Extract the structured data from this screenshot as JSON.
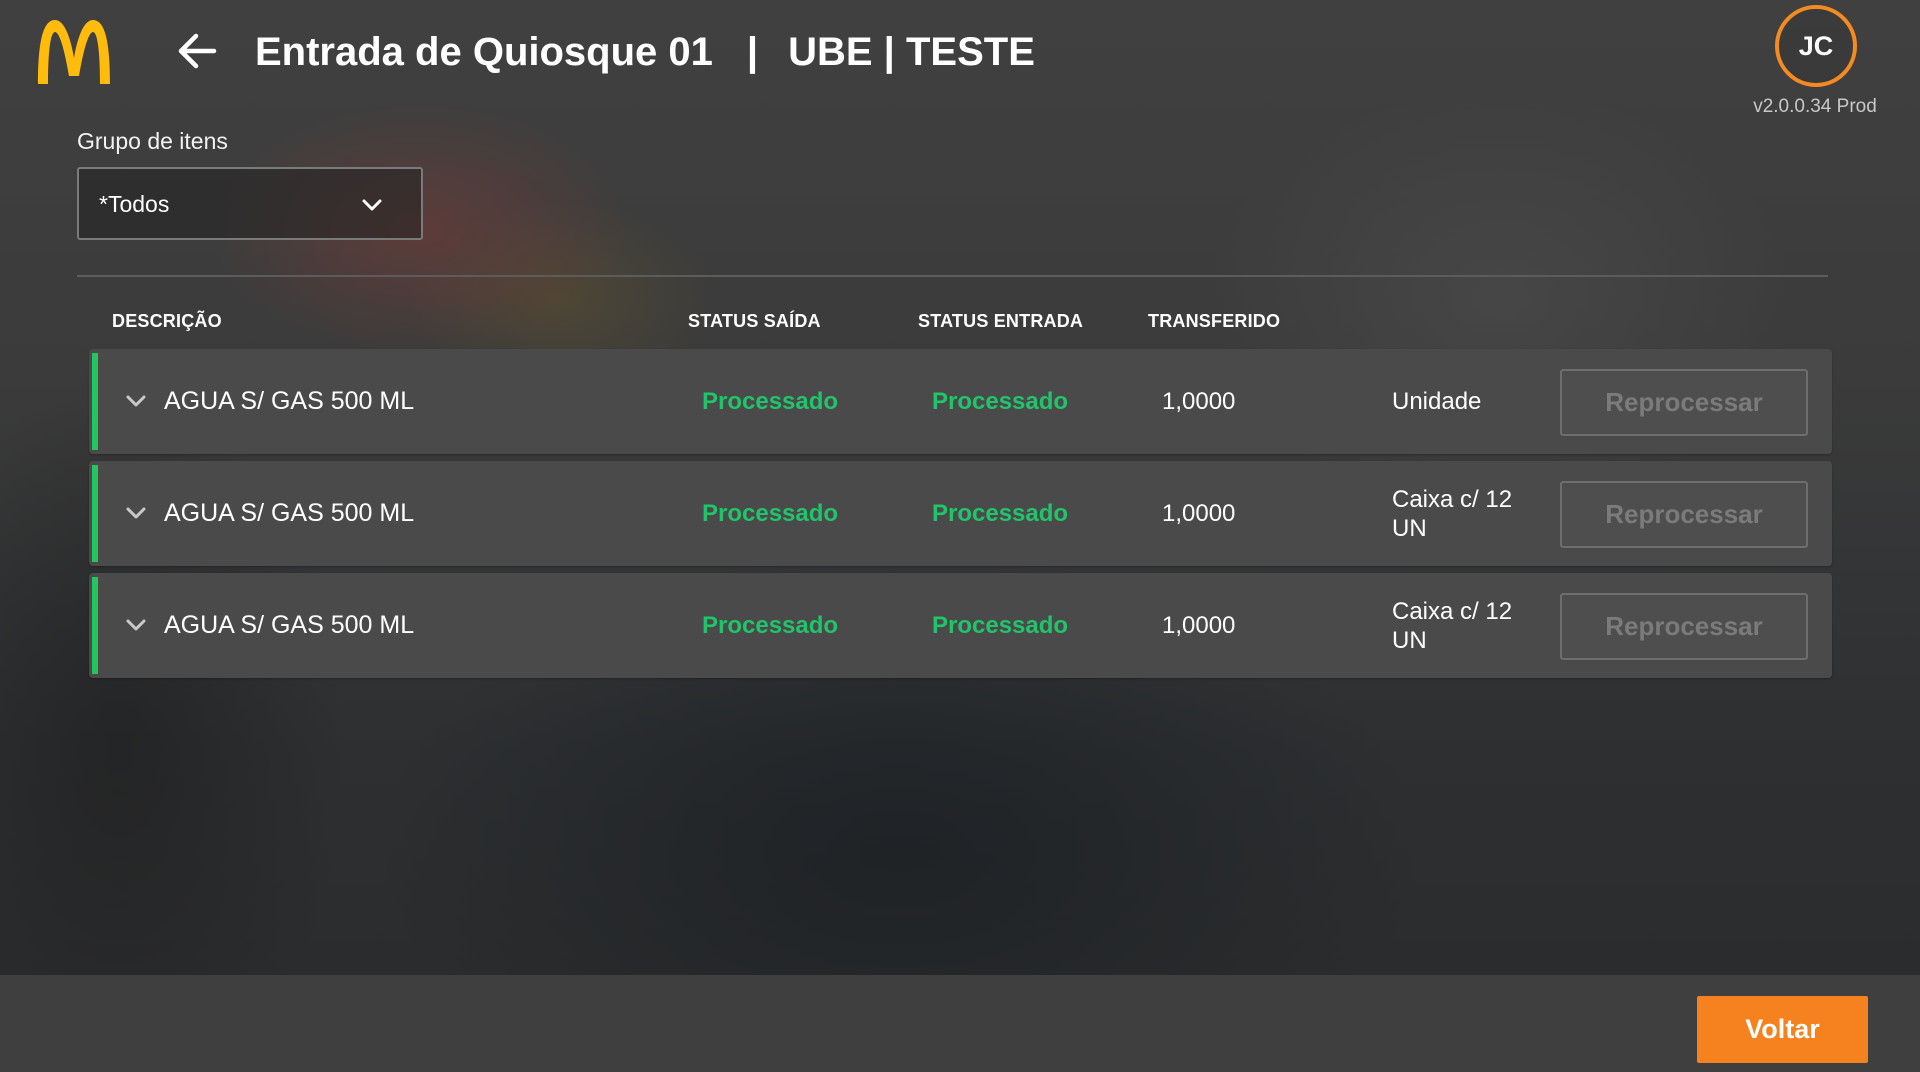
{
  "header": {
    "title": "Entrada de Quiosque 01",
    "separator": "|",
    "store": "UBE | TESTE",
    "avatar_initials": "JC",
    "version": "v2.0.0.34 Prod"
  },
  "filter": {
    "label": "Grupo de itens",
    "selected": "*Todos"
  },
  "table": {
    "headers": {
      "description": "DESCRIÇÃO",
      "status_out": "STATUS SAÍDA",
      "status_in": "STATUS ENTRADA",
      "transferred": "TRANSFERIDO"
    },
    "rows": [
      {
        "description": "AGUA S/ GAS 500 ML",
        "status_out": "Processado",
        "status_in": "Processado",
        "transferred": "1,0000",
        "unit": "Unidade",
        "action": "Reprocessar"
      },
      {
        "description": "AGUA S/ GAS 500 ML",
        "status_out": "Processado",
        "status_in": "Processado",
        "transferred": "1,0000",
        "unit": "Caixa c/ 12 UN",
        "action": "Reprocessar"
      },
      {
        "description": "AGUA S/ GAS 500 ML",
        "status_out": "Processado",
        "status_in": "Processado",
        "transferred": "1,0000",
        "unit": "Caixa c/ 12 UN",
        "action": "Reprocessar"
      }
    ]
  },
  "footer": {
    "back_label": "Voltar"
  },
  "colors": {
    "accent_orange": "#f5821f",
    "status_green": "#21c46a",
    "logo_yellow": "#ffbc0d"
  },
  "icons": {
    "logo": "golden-arches-logo",
    "back": "arrow-left-icon",
    "dropdown": "chevron-down-icon",
    "expand": "chevron-down-icon"
  }
}
